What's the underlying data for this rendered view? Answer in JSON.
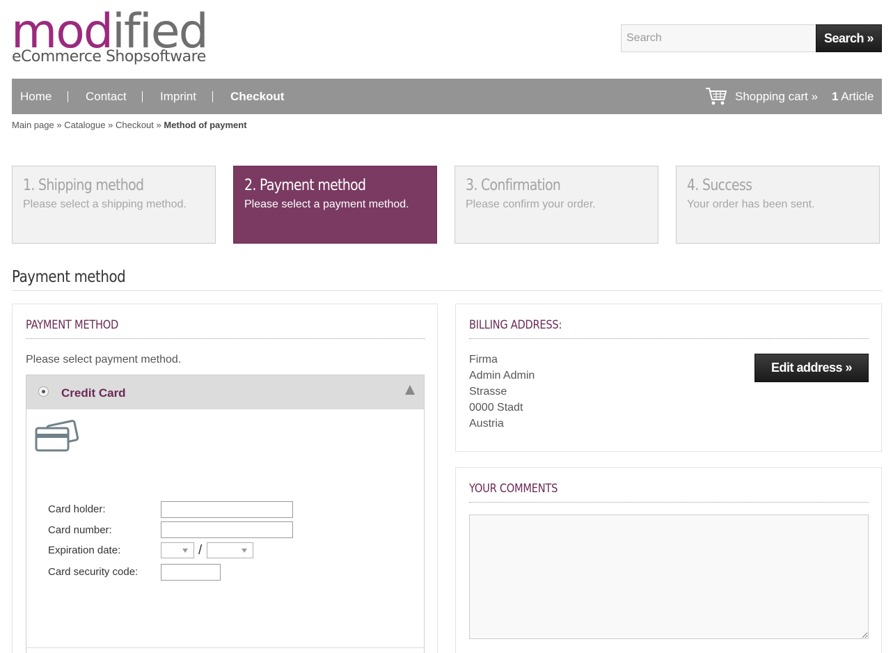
{
  "logo": {
    "main_part1": "mod",
    "main_part2": "ified",
    "sub": "eCommerce Shopsoftware"
  },
  "search": {
    "placeholder": "Search",
    "button_label": "Search »"
  },
  "nav": {
    "items": [
      "Home",
      "Contact",
      "Imprint",
      "Checkout"
    ],
    "cart_label": "Shopping cart »",
    "cart_count": "1",
    "cart_unit": "Article"
  },
  "breadcrumb": {
    "items": [
      "Main page",
      "Catalogue",
      "Checkout"
    ],
    "separator": "»",
    "current": "Method of payment"
  },
  "steps": [
    {
      "title": "1. Shipping method",
      "desc": "Please select a shipping method."
    },
    {
      "title": "2. Payment method",
      "desc": "Please select a payment method."
    },
    {
      "title": "3. Confirmation",
      "desc": "Please confirm your order."
    },
    {
      "title": "4. Success",
      "desc": "Your order has been sent."
    }
  ],
  "active_step": 2,
  "page_heading": "Payment method",
  "payment": {
    "title": "PAYMENT METHOD",
    "intro": "Please select payment method.",
    "option_label": "Credit Card",
    "form": {
      "holder_label": "Card holder:",
      "number_label": "Card number:",
      "expiry_label": "Expiration date:",
      "expiry_separator": "/",
      "cvc_label": "Card security code:"
    }
  },
  "billing": {
    "title": "BILLING ADDRESS:",
    "lines": [
      "Firma",
      "Admin Admin",
      "Strasse",
      "0000 Stadt",
      "Austria"
    ],
    "edit_button": "Edit address »"
  },
  "comments": {
    "title": "YOUR COMMENTS"
  },
  "colors": {
    "brand": "#9b2a7e",
    "active_step": "#7a3a62",
    "nav_bar": "#949494",
    "heading_accent": "#6b2a55"
  }
}
